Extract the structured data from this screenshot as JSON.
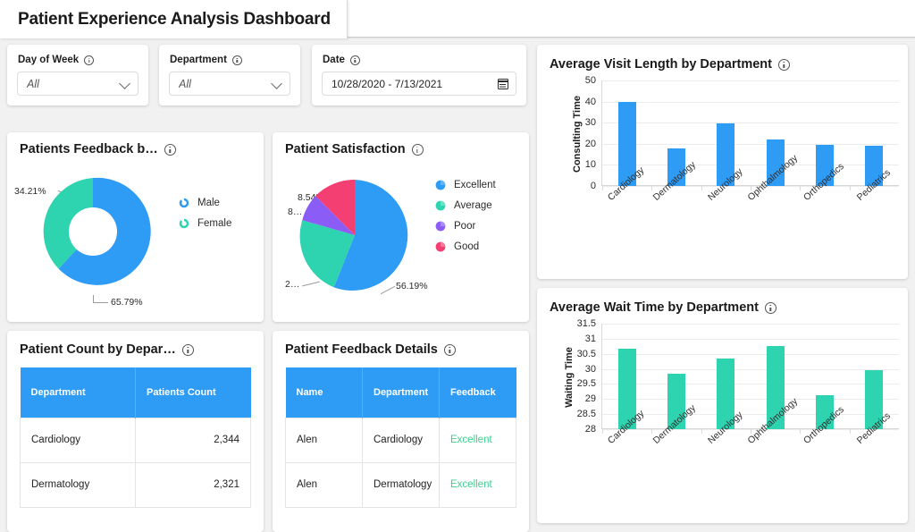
{
  "header": {
    "tab_title": "Patient Experience Analysis Dashboard"
  },
  "filters": [
    {
      "label": "Day of Week",
      "value": "All",
      "icon": "chevron-down-icon"
    },
    {
      "label": "Department",
      "value": "All",
      "icon": "chevron-down-icon"
    },
    {
      "label": "Date",
      "value": "10/28/2020 - 7/13/2021",
      "icon": "calendar-icon"
    }
  ],
  "cards": {
    "feedback_gender": {
      "title": "Patients Feedback b…"
    },
    "satisfaction": {
      "title": "Patient Satisfaction"
    },
    "visit_length": {
      "title": "Average Visit Length by Department"
    },
    "wait_time": {
      "title": "Average Wait Time by Department"
    },
    "patient_count": {
      "title": "Patient Count by Depar…"
    },
    "feedback_details": {
      "title": "Patient Feedback Details"
    }
  },
  "colors": {
    "blue": "#2e9bf5",
    "teal": "#2ed3b0",
    "purple": "#8b5cf6",
    "pink": "#f43f72",
    "good_text": "#3ecf8e",
    "header_blue": "#2e9bf5"
  },
  "chart_data": [
    {
      "id": "patients-feedback-by-gender",
      "type": "pie",
      "title": "Patients Feedback b…",
      "donut": true,
      "labels": [
        "Male",
        "Female"
      ],
      "values": [
        65.79,
        34.21
      ],
      "value_labels": [
        "65.79%",
        "34.21%"
      ],
      "colors": [
        "#2e9bf5",
        "#2ed3b0"
      ],
      "legend_position": "right"
    },
    {
      "id": "patient-satisfaction",
      "type": "pie",
      "title": "Patient Satisfaction",
      "donut": false,
      "labels": [
        "Excellent",
        "Average",
        "Poor",
        "Good"
      ],
      "values": [
        56.19,
        26.47,
        8.8,
        8.54
      ],
      "value_labels": [
        "56.19%",
        "2…",
        "8…",
        "8.54%"
      ],
      "colors": [
        "#2e9bf5",
        "#2ed3b0",
        "#8b5cf6",
        "#f43f72"
      ],
      "legend_position": "right"
    },
    {
      "id": "average-visit-length-by-department",
      "type": "bar",
      "title": "Average Visit Length by Department",
      "categories": [
        "Cardiology",
        "Dermatology",
        "Neurology",
        "Ophthalmology",
        "Orthopedics",
        "Pediatrics"
      ],
      "values": [
        39.7,
        18.0,
        29.5,
        22.0,
        19.6,
        19.0
      ],
      "xlabel": "",
      "ylabel": "Consulting Time",
      "yticks": [
        0,
        10,
        20,
        30,
        40,
        50
      ],
      "ylim": [
        0,
        50
      ],
      "color": "#2e9bf5",
      "grid": true
    },
    {
      "id": "average-wait-time-by-department",
      "type": "bar",
      "title": "Average Wait Time by Department",
      "categories": [
        "Cardiology",
        "Dermatology",
        "Neurology",
        "Ophthalmology",
        "Orthopedics",
        "Pediatrics"
      ],
      "values": [
        30.68,
        29.85,
        30.35,
        30.77,
        29.12,
        29.97
      ],
      "xlabel": "",
      "ylabel": "Waiting Time",
      "yticks": [
        28,
        28.5,
        29,
        29.5,
        30,
        30.5,
        31,
        31.5
      ],
      "ylim": [
        28,
        31.5
      ],
      "color": "#2ed3b0",
      "grid": true
    },
    {
      "id": "patient-count-by-department",
      "type": "table",
      "title": "Patient Count by Depar…",
      "columns": [
        "Department",
        "Patients Count"
      ],
      "rows": [
        [
          "Cardiology",
          "2,344"
        ],
        [
          "Dermatology",
          "2,321"
        ]
      ]
    },
    {
      "id": "patient-feedback-details",
      "type": "table",
      "title": "Patient Feedback Details",
      "columns": [
        "Name",
        "Department",
        "Feedback"
      ],
      "rows": [
        [
          "Alen",
          "Cardiology",
          "Excellent"
        ],
        [
          "Alen",
          "Dermatology",
          "Excellent"
        ]
      ]
    }
  ]
}
